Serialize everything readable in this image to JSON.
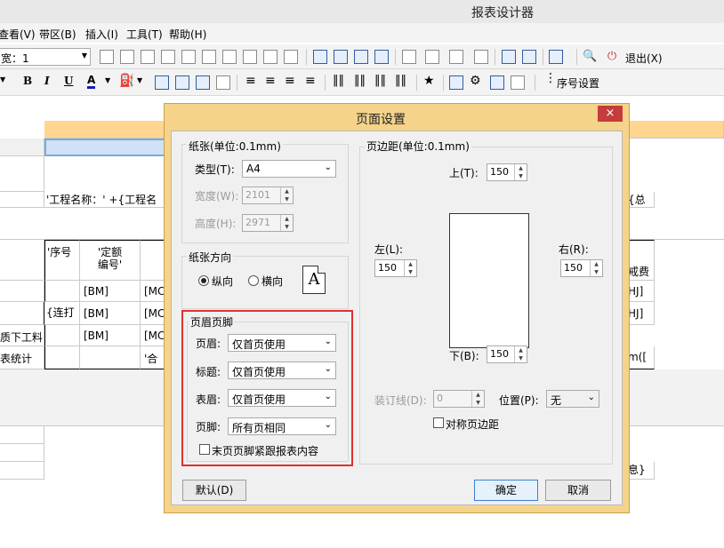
{
  "window": {
    "title": "报表设计器"
  },
  "menu": [
    "查看(V)",
    "带区(B)",
    "插入(I)",
    "工具(T)",
    "帮助(H)"
  ],
  "toolbar": {
    "width_combo": "宽：1",
    "exit_label": "退出(X)",
    "bold": "B",
    "italic": "I",
    "underline": "U",
    "font_color": "A",
    "star": "★",
    "seq_label": "序号设置"
  },
  "sheet": {
    "row_expr": "'工程名称：' +{工程名",
    "row_expr_right": "{总",
    "col_seq": "'序号",
    "col_code_line1": "'定额",
    "col_code_line2": "编号'",
    "right_fee": "戒费",
    "bm": "[BM]",
    "mc": "[MC",
    "hj": "HJ]",
    "lian": "{连打",
    "xia": "质下工料",
    "tongji": "表统计",
    "he": "'合",
    "m": "m([",
    "xi": "息}"
  },
  "dialog": {
    "title": "页面设置",
    "close": "×",
    "paper": {
      "group_label": "纸张(单位:0.1mm)",
      "type_label": "类型(T):",
      "type_value": "A4",
      "width_label": "宽度(W):",
      "width_value": "2101",
      "height_label": "高度(H):",
      "height_value": "2971"
    },
    "orientation": {
      "group_label": "纸张方向",
      "portrait": "纵向",
      "landscape": "横向",
      "icon_letter": "A"
    },
    "header_footer": {
      "group_label": "页眉页脚",
      "header_label": "页眉:",
      "header_value": "仅首页使用",
      "title_label": "标题:",
      "title_value": "仅首页使用",
      "table_header_label": "表眉:",
      "table_header_value": "仅首页使用",
      "footer_label": "页脚:",
      "footer_value": "所有页相同",
      "last_page_check": "末页页脚紧跟报表内容"
    },
    "margins": {
      "group_label": "页边距(单位:0.1mm)",
      "top_label": "上(T):",
      "top_value": "150",
      "left_label": "左(L):",
      "left_value": "150",
      "right_label": "右(R):",
      "right_value": "150",
      "bottom_label": "下(B):",
      "bottom_value": "150",
      "gutter_label": "装订线(D):",
      "gutter_value": "0",
      "position_label": "位置(P):",
      "position_value": "无",
      "symmetric": "对称页边距"
    },
    "buttons": {
      "default": "默认(D)",
      "ok": "确定",
      "cancel": "取消"
    }
  }
}
